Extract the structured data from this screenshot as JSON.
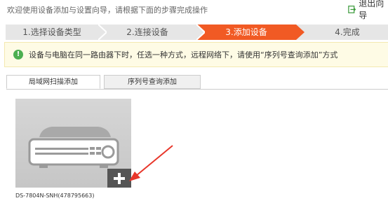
{
  "header": {
    "instruction": "欢迎使用设备添加与设置向导，请根据下面的步骤完成操作",
    "exit_label": "退出向导",
    "exit_icon": "exit-icon"
  },
  "steps": [
    {
      "label": "1.选择设备类型",
      "active": false
    },
    {
      "label": "2.连接设备",
      "active": false
    },
    {
      "label": "3.添加设备",
      "active": true
    },
    {
      "label": "4.完成",
      "active": false
    }
  ],
  "notice": {
    "icon": "info-icon",
    "text": "设备与电脑在同一路由器下时，任选一种方式，远程网络下，请使用“序列号查询添加”方式"
  },
  "tabs": [
    {
      "label": "局域网扫描添加",
      "active": true
    },
    {
      "label": "序列号查询添加",
      "active": false
    }
  ],
  "devices": [
    {
      "name": "DS-7804N-SNH(478795663)",
      "add_icon": "plus-icon"
    }
  ],
  "colors": {
    "accent": "#f15a24",
    "step_bg": "#e6e6e6",
    "notice_bg": "#fefbe5",
    "arrow": "#e8362a"
  }
}
